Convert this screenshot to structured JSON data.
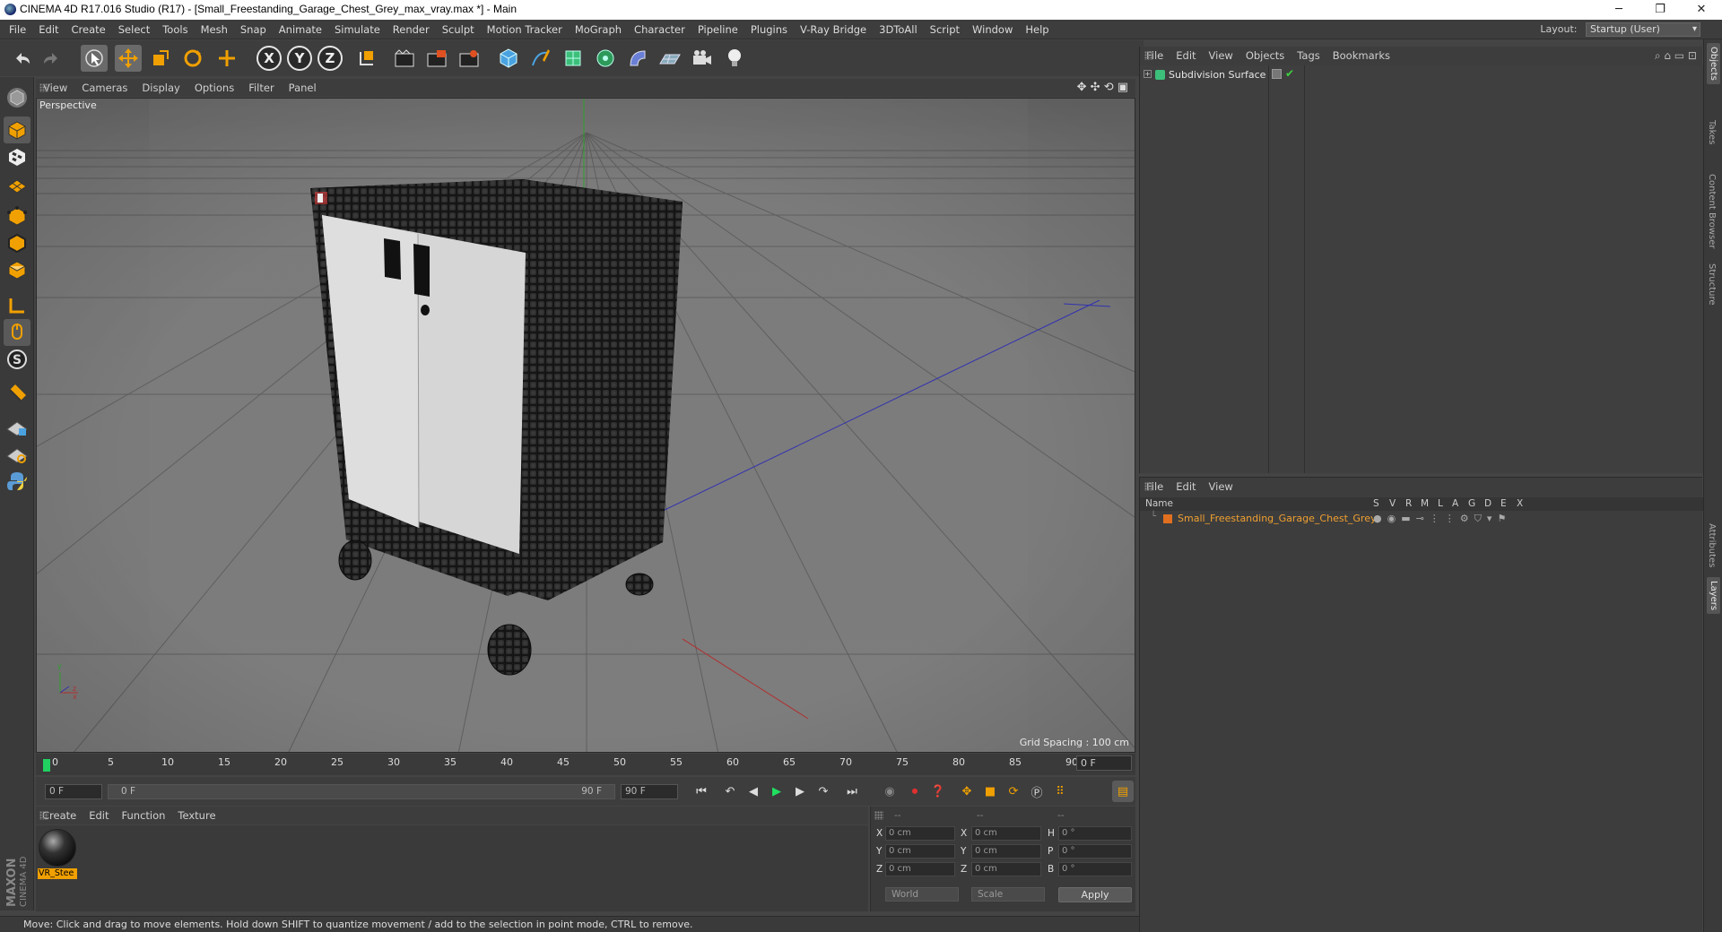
{
  "window": {
    "title": "CINEMA 4D R17.016 Studio (R17) - [Small_Freestanding_Garage_Chest_Grey_max_vray.max *] - Main"
  },
  "menubar": {
    "items": [
      "File",
      "Edit",
      "Create",
      "Select",
      "Tools",
      "Mesh",
      "Snap",
      "Animate",
      "Simulate",
      "Render",
      "Sculpt",
      "Motion Tracker",
      "MoGraph",
      "Character",
      "Pipeline",
      "Plugins",
      "V-Ray Bridge",
      "3DToAll",
      "Script",
      "Window",
      "Help"
    ],
    "layout_label": "Layout:",
    "layout_value": "Startup (User)"
  },
  "toolbar": {
    "axis_x": "X",
    "axis_y": "Y",
    "axis_z": "Z"
  },
  "viewport": {
    "menu": [
      "View",
      "Cameras",
      "Display",
      "Options",
      "Filter",
      "Panel"
    ],
    "label": "Perspective",
    "grid_spacing": "Grid Spacing : 100 cm"
  },
  "timeline": {
    "ticks": [
      "0",
      "5",
      "10",
      "15",
      "20",
      "25",
      "30",
      "35",
      "40",
      "45",
      "50",
      "55",
      "60",
      "65",
      "70",
      "75",
      "80",
      "85",
      "90"
    ],
    "current_frame": "0 F",
    "start_field": "0 F",
    "range_start": "0 F",
    "range_end": "90 F",
    "end_field": "90 F"
  },
  "material_manager": {
    "menu": [
      "Create",
      "Edit",
      "Function",
      "Texture"
    ],
    "material_name": "VR_Stee"
  },
  "coordinates": {
    "header": [
      "--",
      "--",
      "--"
    ],
    "rows": [
      {
        "pos_label": "X",
        "pos": "0 cm",
        "size_label": "X",
        "size": "0 cm",
        "rot_label": "H",
        "rot": "0 °"
      },
      {
        "pos_label": "Y",
        "pos": "0 cm",
        "size_label": "Y",
        "size": "0 cm",
        "rot_label": "P",
        "rot": "0 °"
      },
      {
        "pos_label": "Z",
        "pos": "0 cm",
        "size_label": "Z",
        "size": "0 cm",
        "rot_label": "B",
        "rot": "0 °"
      }
    ],
    "mode": "World",
    "size_mode": "Scale",
    "apply": "Apply"
  },
  "object_manager": {
    "menu": [
      "File",
      "Edit",
      "View",
      "Objects",
      "Tags",
      "Bookmarks"
    ],
    "object_name": "Subdivision Surface"
  },
  "layer_manager": {
    "menu": [
      "File",
      "Edit",
      "View"
    ],
    "columns": [
      "Name",
      "S",
      "V",
      "R",
      "M",
      "L",
      "A",
      "G",
      "D",
      "E",
      "X"
    ],
    "layer_name": "Small_Freestanding_Garage_Chest_Grey"
  },
  "side_tabs": [
    "Objects",
    "Takes",
    "Content Browser",
    "Structure",
    "Attributes",
    "Layers"
  ],
  "statusbar": {
    "text": "Move: Click and drag to move elements. Hold down SHIFT to quantize movement / add to the selection in point mode, CTRL to remove."
  },
  "brand": {
    "maxon": "MAXON",
    "c4d": "CINEMA 4D"
  },
  "colors": {
    "accent_orange": "#f0a000",
    "viewport_bg": "#787878",
    "panel_bg": "#3d3d3d"
  }
}
